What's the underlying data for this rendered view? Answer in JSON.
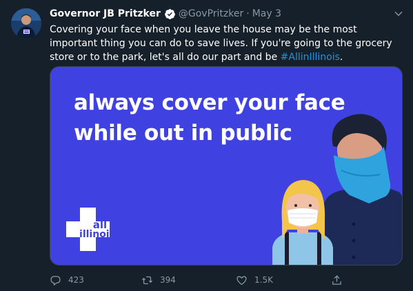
{
  "tweet": {
    "author_name": "Governor JB Pritzker",
    "handle": "@GovPritzker",
    "separator": "·",
    "date": "May 3",
    "text": "Covering your face when you leave the house may be the most important thing you can do to save lives. If you're going to the grocery store or to the park, let's all do our part and be ",
    "hashtag": "#AllinIllinois",
    "text_end": "."
  },
  "media": {
    "headline_line1": "always cover your face",
    "headline_line2": "while out in public",
    "logo_line1": "all",
    "logo_line2": "illinois"
  },
  "actions": {
    "replies": "423",
    "retweets": "394",
    "likes": "1.5K"
  },
  "colors": {
    "background": "#15202b",
    "media_bg": "#3f42e0",
    "link": "#1b95e0",
    "muted": "#8899a6"
  },
  "icons": [
    "verified-badge-icon",
    "chevron-down-icon",
    "reply-icon",
    "retweet-icon",
    "like-icon",
    "share-icon"
  ]
}
